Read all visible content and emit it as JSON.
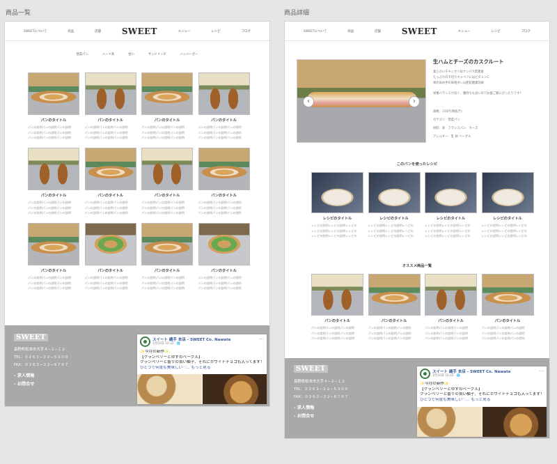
{
  "left_frame_label": "商品一覧",
  "right_frame_label": "商品詳細",
  "nav": {
    "about": "SWEETについて",
    "products": "商品",
    "shops": "店舗",
    "logo": "SWEET",
    "menu": "メニュー",
    "recipe": "レシピ",
    "blog": "ブログ"
  },
  "categories": [
    "惣菜パン",
    "ハード系",
    "甘い",
    "サンドイッチ",
    "ハンバーガー"
  ],
  "card_title": "パンのタイトル",
  "card_desc_line": "パンの説明パンの説明パンの説明",
  "recipe_title": "レシピのタイトル",
  "recipe_desc_line": "レシピの説明レシピの説明レシピの",
  "product_tiles": [
    "sandwich",
    "bun",
    "sandwich",
    "bun",
    "bun",
    "sandwich",
    "bun",
    "sandwich",
    "sandwich",
    "burger",
    "sandwich",
    "burger"
  ],
  "footer": {
    "logo": "SWEET",
    "address": "長野県松本市大手４−２−１２",
    "tel": "TEL：０２６３−３２−５３００",
    "fax": "FAX：０２６３−３２−６７６７",
    "jobs": "- 求人情報",
    "contact": "- お問合せ"
  },
  "facebook": {
    "page": "スイート 縄手 本店 - SWEET Co. Nawate",
    "date": "1月10日 10:22 · 🌐",
    "more": "…",
    "lines": [
      "✨今月の新作✨",
      "【クランベリーとゆずのベーグル】",
      "クランベリーと香りの良い柚子、それにホワイトチョコも入ってます！",
      "ひとつで何度も美味しい♡… もっと見る"
    ]
  },
  "detail": {
    "title": "生ハムとチーズのカスクルート",
    "desc": [
      "柔らかいチキンカツはケンパク質豊富",
      "たっぷりの千切りキャベツにはビタミンC",
      "体の床め手の味噌ダレは亜鉛健康効果"
    ],
    "desc2": "栄養バランスが良く、腹持ちも良いのでお昼ご飯にぴったりです！",
    "price": "価格：150円(税抜き)",
    "category": "カテゴリ：惣菜パン",
    "ingredients": "材料：卵　フランスパン　チーズ",
    "allergy": "アレルギー：乳 卵 ベーグル"
  },
  "section_recipes": "このパンを使ったレシピ",
  "section_recommend": "オススメ商品一覧",
  "recommend_tiles": [
    "bun",
    "sandwich",
    "bun",
    "sandwich"
  ],
  "colors": {
    "footer": "#a9a9a9",
    "fb_blue": "#3b5998",
    "background": "#e5e5e5"
  }
}
